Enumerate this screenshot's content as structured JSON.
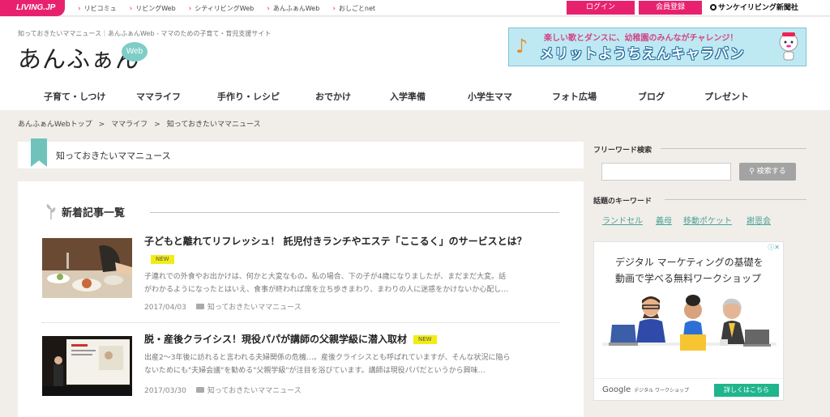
{
  "topbar": {
    "logo": "LIVING.JP",
    "links": [
      "リビコミュ",
      "リビングWeb",
      "シティリビングWeb",
      "あんふぁんWeb",
      "おしごとnet"
    ],
    "login": "ログイン",
    "register": "会員登録",
    "publisher": "サンケイリビング新聞社"
  },
  "header": {
    "tagline": "知っておきたいママニュース｜あんふぁんWeb - ママのための子育て・育児支援サイト",
    "logo_text": "あんふぁん",
    "logo_web": "Web",
    "banner_top": "楽しい歌とダンスに、幼稚園のみんながチャレンジ！",
    "banner_main": "メリットようちえんキャラバン"
  },
  "nav": {
    "items": [
      "子育て・しつけ",
      "ママライフ",
      "手作り・レシピ",
      "おでかけ",
      "入学準備",
      "小学生ママ",
      "フォト広場",
      "ブログ",
      "プレゼント"
    ]
  },
  "breadcrumb": {
    "items": [
      "あんふぁんWebトップ",
      "ママライフ",
      "知っておきたいママニュース"
    ],
    "sep": ">"
  },
  "page_title": "知っておきたいママニュース",
  "section_title": "新着記事一覧",
  "articles": [
    {
      "title": "子どもと離れてリフレッシュ！ 託児付きランチやエステ「ここるく」のサービスとは？",
      "badge": "NEW",
      "body1": "子連れでの外食やお出かけは、何かと大変なもの。私の場合、下の子が4歳になりましたが、まだまだ大変。話",
      "body2": "がわかるようになったとはいえ、食事が終われば席を立ち歩きまわり、まわりの人に迷惑をかけないか心配し…",
      "date": "2017/04/03",
      "category": "知っておきたいママニュース"
    },
    {
      "title": "脱・産後クライシス！現役パパが講師の父親学級に潜入取材",
      "badge": "NEW",
      "body1": "出産2～3年後に訪れると言われる夫婦関係の危機…。産後クライシスとも呼ばれていますが、そんな状況に陥ら",
      "body2": "ないためにも\"夫婦会議\"を勧める\"父親学級\"が注目を浴びています。講師は現役パパだというから興味…",
      "date": "2017/03/30",
      "category": "知っておきたいママニュース"
    }
  ],
  "sidebar": {
    "search_label": "フリーワード検索",
    "search_placeholder": "",
    "search_button": "検索する",
    "keyword_label": "話題のキーワード",
    "keywords": [
      "ランドセル",
      "義母",
      "移動ポケット",
      "謝恩会"
    ]
  },
  "ad": {
    "line1": "デジタル マーケティングの基礎を",
    "line2": "動画で学べる無料ワークショップ",
    "google": "Google",
    "google_sub": "デジタル ワークショップ",
    "button": "詳しくはこちら"
  },
  "colors": {
    "brand_pink": "#e8216f",
    "accent_teal": "#6fc3bb",
    "new_badge": "#f3ec14",
    "page_bg": "#f1eeea"
  }
}
